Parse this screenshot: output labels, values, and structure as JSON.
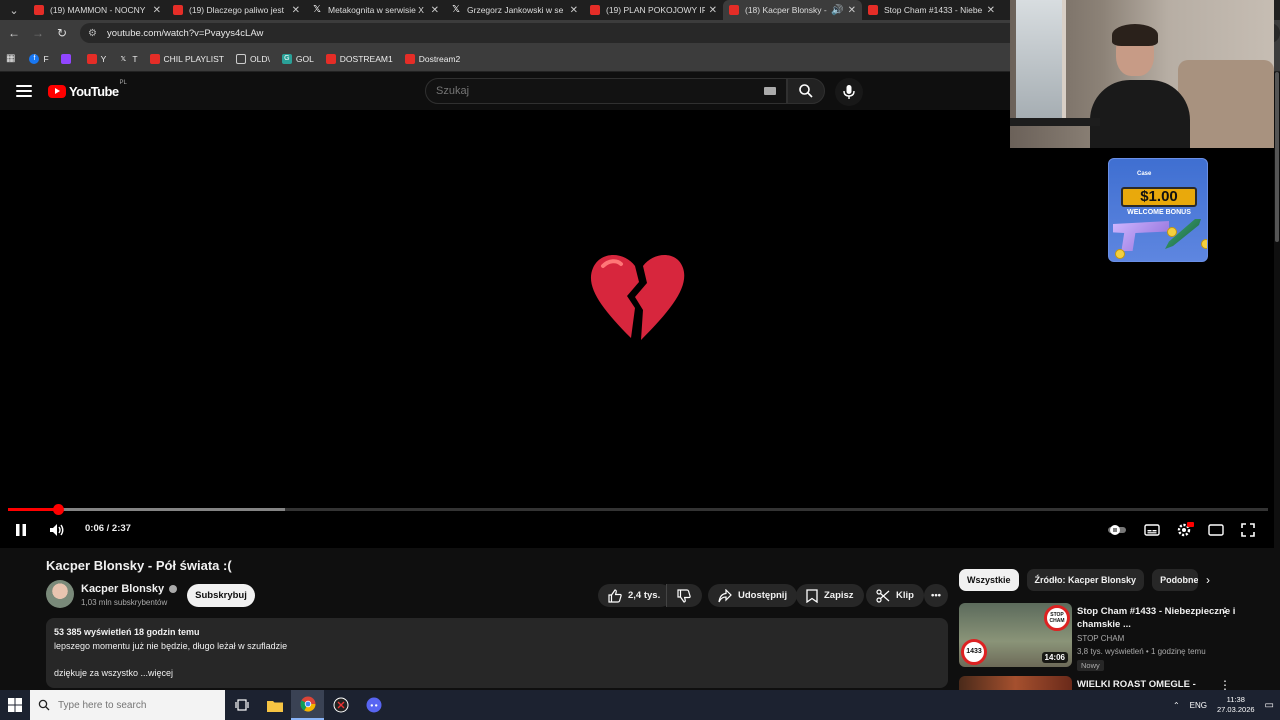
{
  "tabs": [
    {
      "label": "(19) MAMMON - NOCNY",
      "icon": "youtube-icon"
    },
    {
      "label": "(19) Dlaczego paliwo jest",
      "icon": "youtube-icon"
    },
    {
      "label": "Metakognita w serwisie X",
      "icon": "x-icon"
    },
    {
      "label": "Grzegorz Jankowski w se",
      "icon": "x-icon"
    },
    {
      "label": "(19) PLAN POKOJOWY IR",
      "icon": "youtube-icon"
    },
    {
      "label": "(18) Kacper Blonsky -",
      "icon": "youtube-icon",
      "active": true
    },
    {
      "label": "Stop Cham #1433 - Niebe",
      "icon": "youtube-icon"
    }
  ],
  "address": {
    "url": "youtube.com/watch?v=Pvayys4cLAw"
  },
  "bookmarks": [
    {
      "label": "F",
      "icon": "facebook-icon",
      "color": "#1877f2"
    },
    {
      "label": "",
      "icon": "twitch-icon",
      "color": "#9146ff"
    },
    {
      "label": "Y",
      "icon": "youtube-icon",
      "color": "#e52d27"
    },
    {
      "label": "T",
      "icon": "x-icon",
      "color": "#000000"
    },
    {
      "label": "CHIL PLAYLIST",
      "icon": "youtube-icon",
      "color": "#e52d27"
    },
    {
      "label": "OLD\\",
      "icon": "folder-icon",
      "color": "#3c3c3c"
    },
    {
      "label": "GOL",
      "icon": "gol-icon",
      "color": "#2aa198"
    },
    {
      "label": "DOSTREAM1",
      "icon": "youtube-icon",
      "color": "#e52d27"
    },
    {
      "label": "Dostream2",
      "icon": "youtube-icon",
      "color": "#e52d27"
    }
  ],
  "youtube": {
    "logo_text": "YouTube",
    "country_code": "PL",
    "search_placeholder": "Szukaj"
  },
  "player": {
    "current_time": "0:06",
    "duration": "2:37",
    "time_display": "0:06 / 2:37",
    "played_fraction": 0.04,
    "buffered_fraction": 0.22,
    "center_emoji": "💔",
    "settings_badge": "HD"
  },
  "video": {
    "title": "Kacper Blonsky - Pół świata :(",
    "channel": "Kacper Blonsky",
    "subscribers": "1,03 mln subskrybentów",
    "subscribe_label": "Subskrybuj",
    "likes": "2,4 tys.",
    "share_label": "Udostępnij",
    "save_label": "Zapisz",
    "clip_label": "Klip",
    "description": {
      "stats": "53 385 wyświetleń  18 godzin temu",
      "line1": "lepszego momentu już nie będzie, długo leżał w szufladzie",
      "line2": "dziękuje za wszystko ...więcej"
    }
  },
  "sidebar": {
    "chips": [
      "Wszystkie",
      "Źródło: Kacper Blonsky",
      "Podobne"
    ],
    "recommendations": [
      {
        "title": "Stop Cham #1433 - Niebezpieczne i chamskie ...",
        "channel": "STOP CHAM",
        "views": "3,8 tys. wyświetleń • 1 godzinę temu",
        "badge": "Nowy",
        "duration": "14:06",
        "thumb_badge_top": "STOP CHAM",
        "thumb_badge_num": "1433"
      },
      {
        "title": "WIELKI ROAST OMEGLE -",
        "channel": "",
        "views": "",
        "badge": "",
        "duration": ""
      }
    ]
  },
  "ad": {
    "brand": "Case",
    "amount": "$1.00",
    "text": "WELCOME BONUS"
  },
  "taskbar": {
    "search_placeholder": "Type here to search",
    "language": "ENG",
    "time": "11:38",
    "date": "27.03.2026"
  }
}
